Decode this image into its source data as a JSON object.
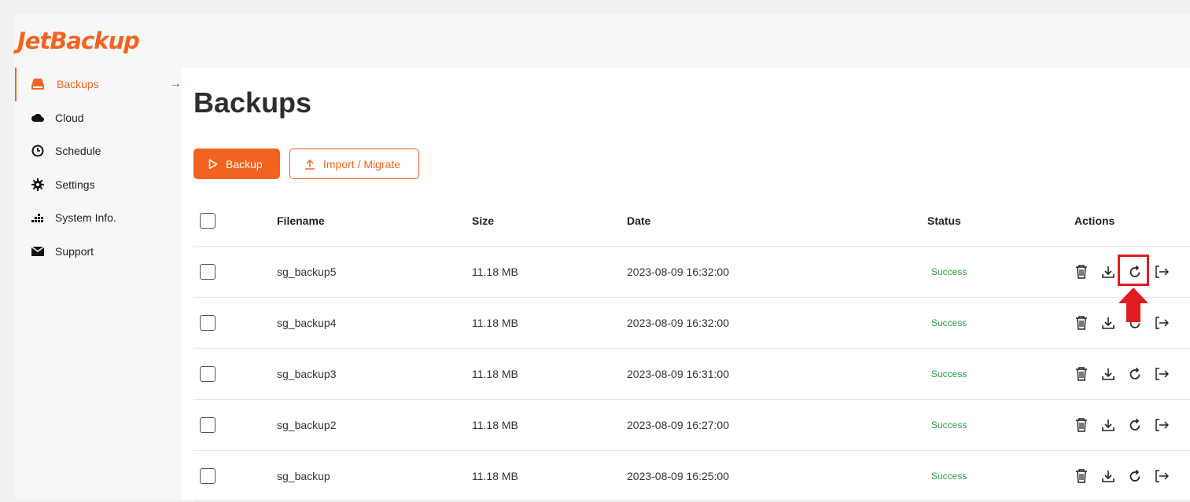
{
  "brand": {
    "logo_text": "JetBackup",
    "accent": "#f26322"
  },
  "sidebar": {
    "items": [
      {
        "label": "Backups",
        "icon": "drive-icon",
        "active": true
      },
      {
        "label": "Cloud",
        "icon": "cloud-icon"
      },
      {
        "label": "Schedule",
        "icon": "clock-icon"
      },
      {
        "label": "Settings",
        "icon": "gear-icon"
      },
      {
        "label": "System Info.",
        "icon": "bars-icon"
      },
      {
        "label": "Support",
        "icon": "envelope-icon"
      }
    ],
    "active_arrow": "→"
  },
  "main": {
    "title": "Backups",
    "buttons": {
      "backup": "Backup",
      "import": "Import / Migrate"
    },
    "table": {
      "headers": {
        "filename": "Filename",
        "size": "Size",
        "date": "Date",
        "status": "Status",
        "actions": "Actions"
      },
      "rows": [
        {
          "filename": "sg_backup5",
          "size": "11.18 MB",
          "date": "2023-08-09 16:32:00",
          "status": "Success"
        },
        {
          "filename": "sg_backup4",
          "size": "11.18 MB",
          "date": "2023-08-09 16:32:00",
          "status": "Success"
        },
        {
          "filename": "sg_backup3",
          "size": "11.18 MB",
          "date": "2023-08-09 16:31:00",
          "status": "Success"
        },
        {
          "filename": "sg_backup2",
          "size": "11.18 MB",
          "date": "2023-08-09 16:27:00",
          "status": "Success"
        },
        {
          "filename": "sg_backup",
          "size": "11.18 MB",
          "date": "2023-08-09 16:25:00",
          "status": "Success"
        }
      ]
    },
    "status_color": "#2e9e45",
    "annotation_color": "#e11b22"
  }
}
